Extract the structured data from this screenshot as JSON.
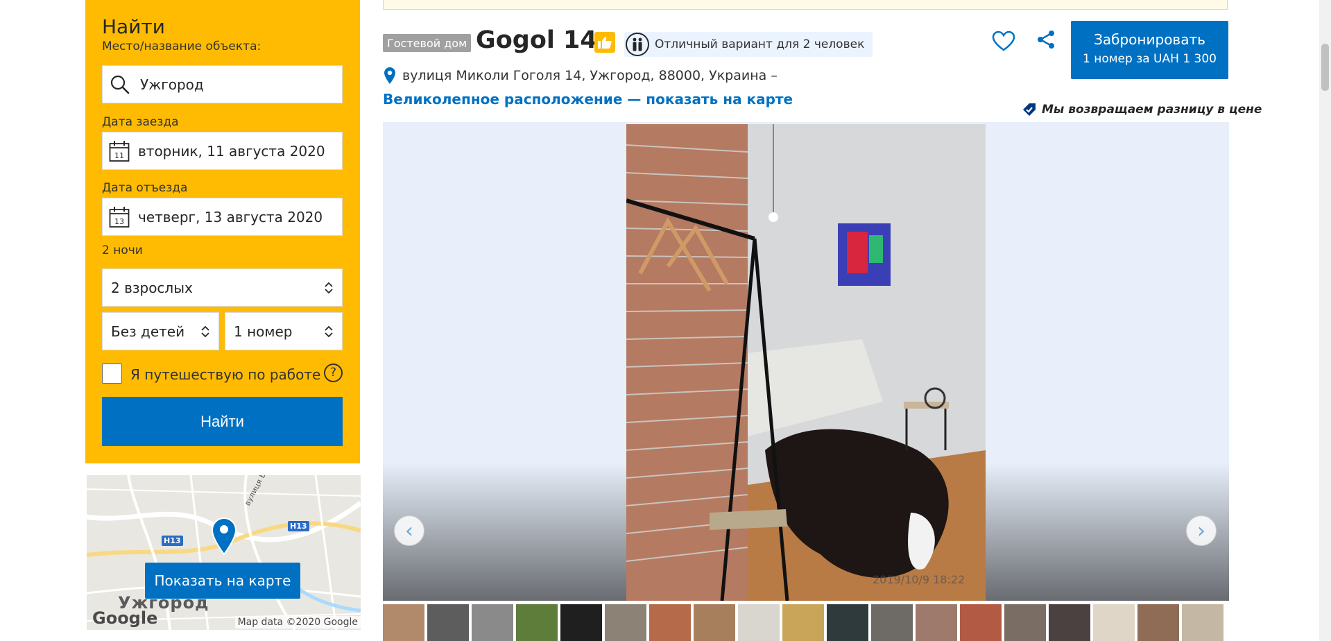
{
  "search": {
    "title": "Найти",
    "destination_label": "Место/название объекта:",
    "destination_value": "Ужгород",
    "checkin_label": "Дата заезда",
    "checkin_day": "11",
    "checkin_value": "вторник, 11 августа 2020",
    "checkout_label": "Дата отъезда",
    "checkout_day": "13",
    "checkout_value": "четверг, 13 августа 2020",
    "nights": "2 ночи",
    "adults": "2 взрослых",
    "children": "Без детей",
    "rooms": "1 номер",
    "work_trip_label": "Я путешествую по работе",
    "help_glyph": "?",
    "submit_label": "Найти"
  },
  "map": {
    "city": "Ужгород",
    "road_1": "H13",
    "road_2": "H13",
    "street": "вулиця Берчені",
    "button_label": "Показать на карте",
    "logo": "Google",
    "credit": "Map data ©2020 Google"
  },
  "property": {
    "type_badge": "Гостевой дом",
    "name": "Gogol 14",
    "preference": "Отличный вариант для 2 человек",
    "address": "вулиця Миколи Гоголя 14, Ужгород, 88000, Украина –",
    "map_link": "Великолепное расположение — показать на карте",
    "price_match": "Мы возвращаем разницу в цене"
  },
  "booking": {
    "button_label": "Забронировать",
    "button_sub": "1 номер за UAH 1 300"
  },
  "gallery": {
    "prev_glyph": "‹",
    "next_glyph": "›",
    "photo_stamp": "2019/10/9  18:22",
    "thumbnail_colors": [
      "#b08a6a",
      "#5d5d5d",
      "#8a8a8a",
      "#5e7d3a",
      "#1f1f1f",
      "#8c8376",
      "#b56a4a",
      "#a87f5d",
      "#d9d5cf",
      "#c9a55a",
      "#2f3a3d",
      "#6e6a66",
      "#9d7a6b",
      "#b35a45",
      "#7a6e64",
      "#4a4140",
      "#e0d6c8",
      "#8e6c55",
      "#c4b8a4"
    ]
  },
  "colors": {
    "brand_blue": "#0071c2",
    "search_yellow": "#febb02"
  }
}
